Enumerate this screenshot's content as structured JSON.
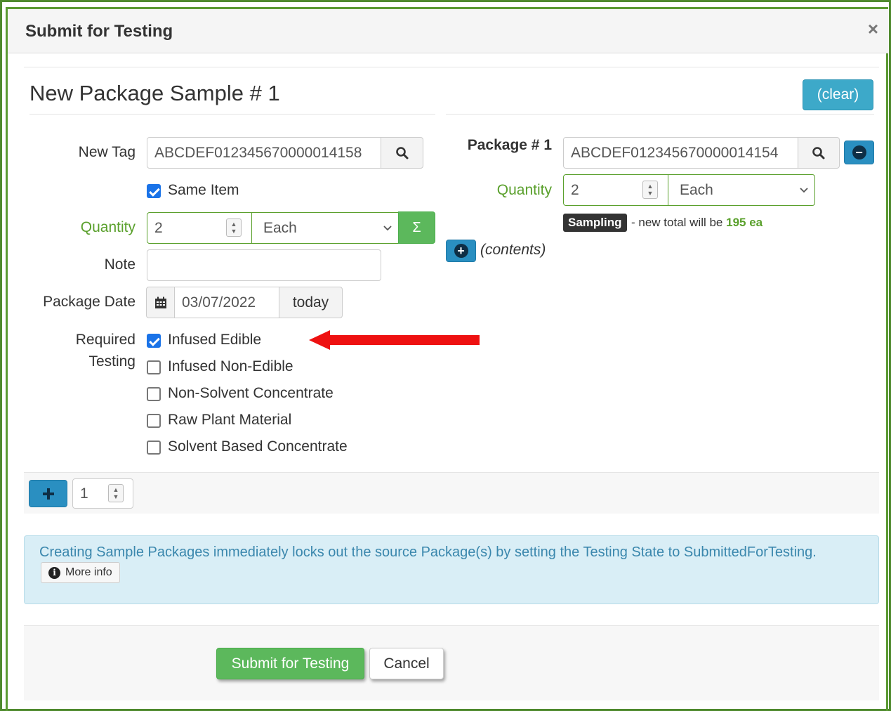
{
  "modal": {
    "title": "Submit for Testing",
    "close_symbol": "×"
  },
  "section": {
    "title": "New Package Sample # 1",
    "clear_label": "(clear)"
  },
  "left": {
    "new_tag_label": "New Tag",
    "new_tag_value": "ABCDEF012345670000014158",
    "same_item_label": "Same Item",
    "same_item_checked": true,
    "quantity_label": "Quantity",
    "quantity_value": "2",
    "unit_value": "Each",
    "sum_symbol": "Σ",
    "note_label": "Note",
    "note_value": "",
    "package_date_label": "Package Date",
    "package_date_value": "03/07/2022",
    "today_label": "today",
    "required_label_1": "Required",
    "required_label_2": "Testing",
    "testing_options": [
      {
        "label": "Infused Edible",
        "checked": true
      },
      {
        "label": "Infused Non-Edible",
        "checked": false
      },
      {
        "label": "Non-Solvent Concentrate",
        "checked": false
      },
      {
        "label": "Raw Plant Material",
        "checked": false
      },
      {
        "label": "Solvent Based Concentrate",
        "checked": false
      }
    ]
  },
  "right": {
    "package_label": "Package # 1",
    "package_value": "ABCDEF012345670000014154",
    "quantity_label": "Quantity",
    "quantity_value": "2",
    "unit_value": "Each",
    "badge": "Sampling",
    "total_prefix": "- new total will be ",
    "total_value": "195 ea",
    "contents_label": "(contents)"
  },
  "add_row": {
    "count_value": "1"
  },
  "info": {
    "message": "Creating Sample Packages immediately locks out the source Package(s) by setting the Testing State to SubmittedForTesting.",
    "more_info_label": "More info"
  },
  "footer": {
    "submit_label": "Submit for Testing",
    "cancel_label": "Cancel"
  },
  "colors": {
    "accent_green": "#5aa02c",
    "button_blue": "#3da9c9",
    "arrow_red": "#ee1111",
    "frame_green": "#4f8a2e"
  }
}
